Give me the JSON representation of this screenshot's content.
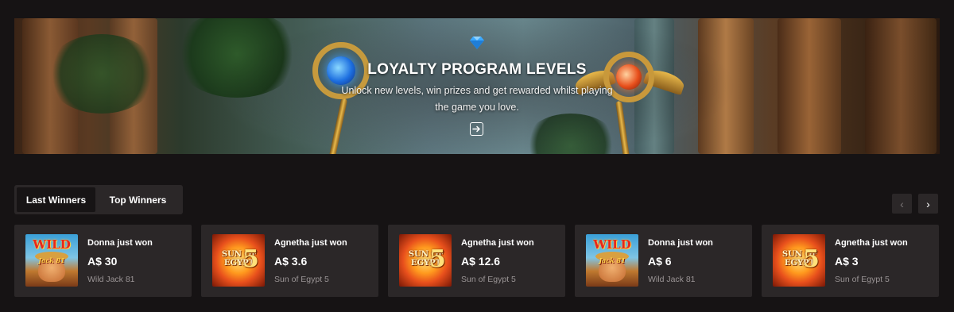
{
  "banner": {
    "title": "LOYALTY PROGRAM LEVELS",
    "subtitle": "Unlock new levels, win prizes and get rewarded whilst playing the game you love.",
    "icon": "diamond-icon",
    "action_icon": "arrow-right-square-icon"
  },
  "tabs": [
    {
      "label": "Last Winners",
      "active": true
    },
    {
      "label": "Top Winners",
      "active": false
    }
  ],
  "carousel": {
    "prev_icon": "chevron-left-icon",
    "next_icon": "chevron-right-icon"
  },
  "winners": [
    {
      "who": "Donna just won",
      "amount": "A$ 30",
      "game": "Wild Jack 81",
      "thumb": "wild",
      "logo_main": "WILD",
      "logo_sub": "Jack 81"
    },
    {
      "who": "Agnetha just won",
      "amount": "A$ 3.6",
      "game": "Sun of Egypt 5",
      "thumb": "sun",
      "logo_main": "SUN OF EGYPT",
      "logo_num": "5"
    },
    {
      "who": "Agnetha just won",
      "amount": "A$ 12.6",
      "game": "Sun of Egypt 5",
      "thumb": "sun",
      "logo_main": "SUN OF EGYPT",
      "logo_num": "5"
    },
    {
      "who": "Donna just won",
      "amount": "A$ 6",
      "game": "Wild Jack 81",
      "thumb": "wild",
      "logo_main": "WILD",
      "logo_sub": "Jack 81"
    },
    {
      "who": "Agnetha just won",
      "amount": "A$ 3",
      "game": "Sun of Egypt 5",
      "thumb": "sun",
      "logo_main": "SUN OF EGYPT",
      "logo_num": "5"
    }
  ],
  "colors": {
    "page_bg": "#161314",
    "card_bg": "#2b2728",
    "muted_text": "#9a9495"
  }
}
